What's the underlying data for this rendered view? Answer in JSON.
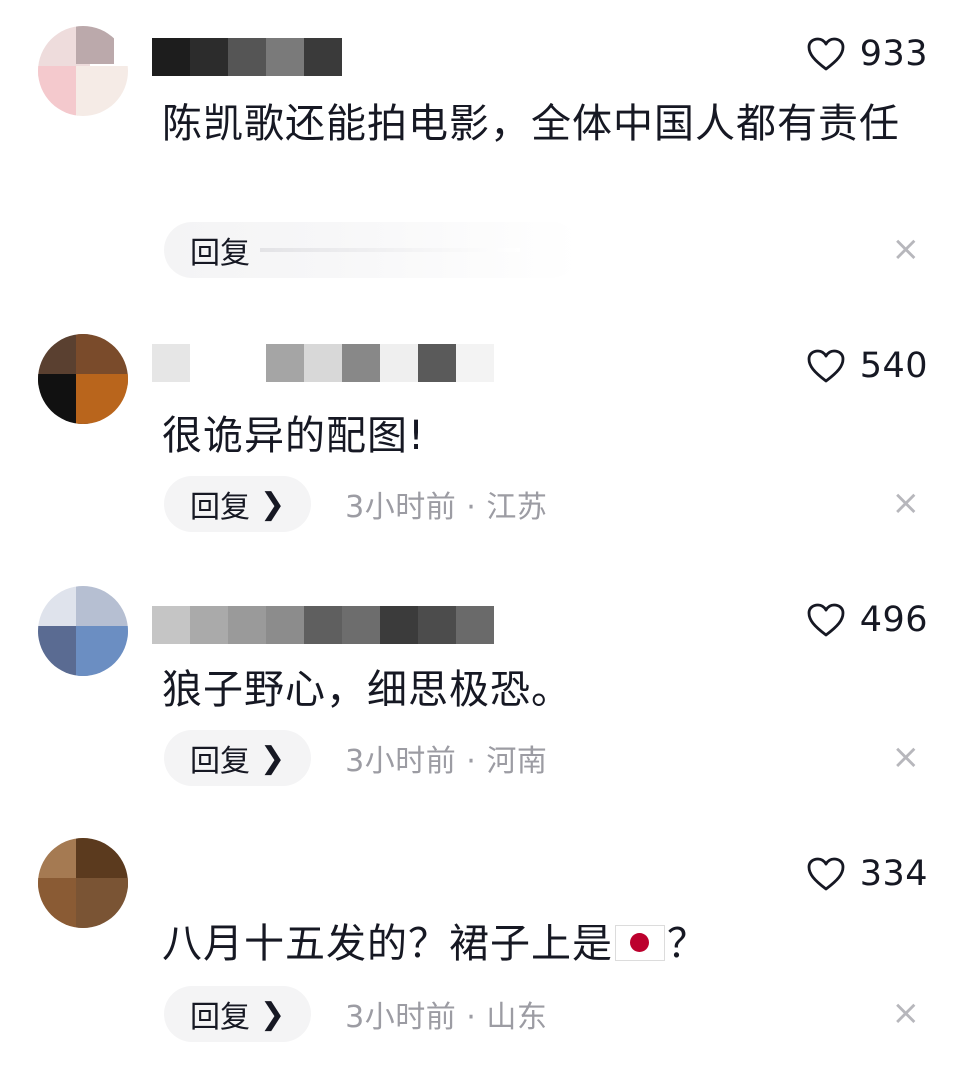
{
  "comments": [
    {
      "likes": "933",
      "text": "陈凯歌还能拍电影，全体中国人都有责任",
      "reply_label": "回复",
      "meta": "",
      "close": "×"
    },
    {
      "likes": "540",
      "text": "很诡异的配图!",
      "reply_label": "回复",
      "meta": "3小时前 · 江苏",
      "close": "×"
    },
    {
      "likes": "496",
      "text": "狼子野心，细思极恐。",
      "reply_label": "回复",
      "meta": "3小时前 · 河南",
      "close": "×"
    },
    {
      "likes": "334",
      "text_before": "八月十五发的？裙子上是",
      "text_after": "？",
      "flag_icon": "japan-flag-emoji",
      "reply_label": "回复",
      "meta": "3小时前 · 山东",
      "close": "×"
    }
  ],
  "icons": {
    "like": "heart-outline-icon",
    "close": "close-icon",
    "chevron": "chevron-right-icon"
  },
  "colors": {
    "text": "#161823",
    "meta": "#9c9ca3",
    "reply_bg": "#f4f4f5",
    "flag_red": "#bc002d"
  }
}
